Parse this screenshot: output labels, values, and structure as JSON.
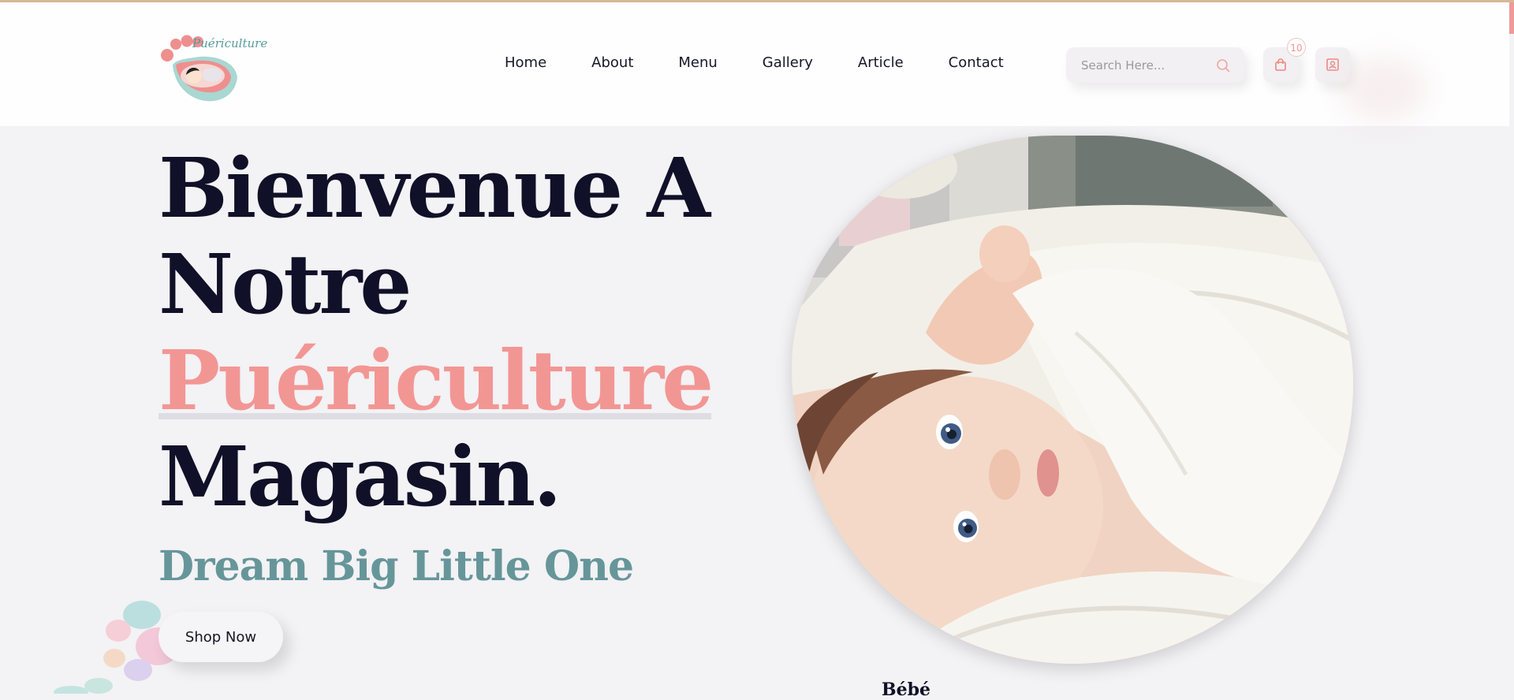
{
  "brand": {
    "logo_text": "Puériculture"
  },
  "nav": {
    "items": [
      {
        "label": "Home"
      },
      {
        "label": "About"
      },
      {
        "label": "Menu"
      },
      {
        "label": "Gallery"
      },
      {
        "label": "Article"
      },
      {
        "label": "Contact"
      }
    ]
  },
  "search": {
    "placeholder": "Search Here..."
  },
  "cart": {
    "count": "10"
  },
  "hero": {
    "line1": "Bienvenue A",
    "line2": "Notre",
    "line3": "Puériculture",
    "line4": "Magasin.",
    "subtitle": "Dream Big Little One",
    "cta": "Shop Now"
  },
  "peek": {
    "text": "Bébé"
  },
  "colors": {
    "accent_pink": "#f29694",
    "teal": "#66969a",
    "heading": "#101028",
    "page_bg": "#f3f2f5",
    "top_accent": "#d8b896"
  },
  "icons": [
    "search-icon",
    "shopping-bag-icon",
    "user-profile-icon"
  ]
}
